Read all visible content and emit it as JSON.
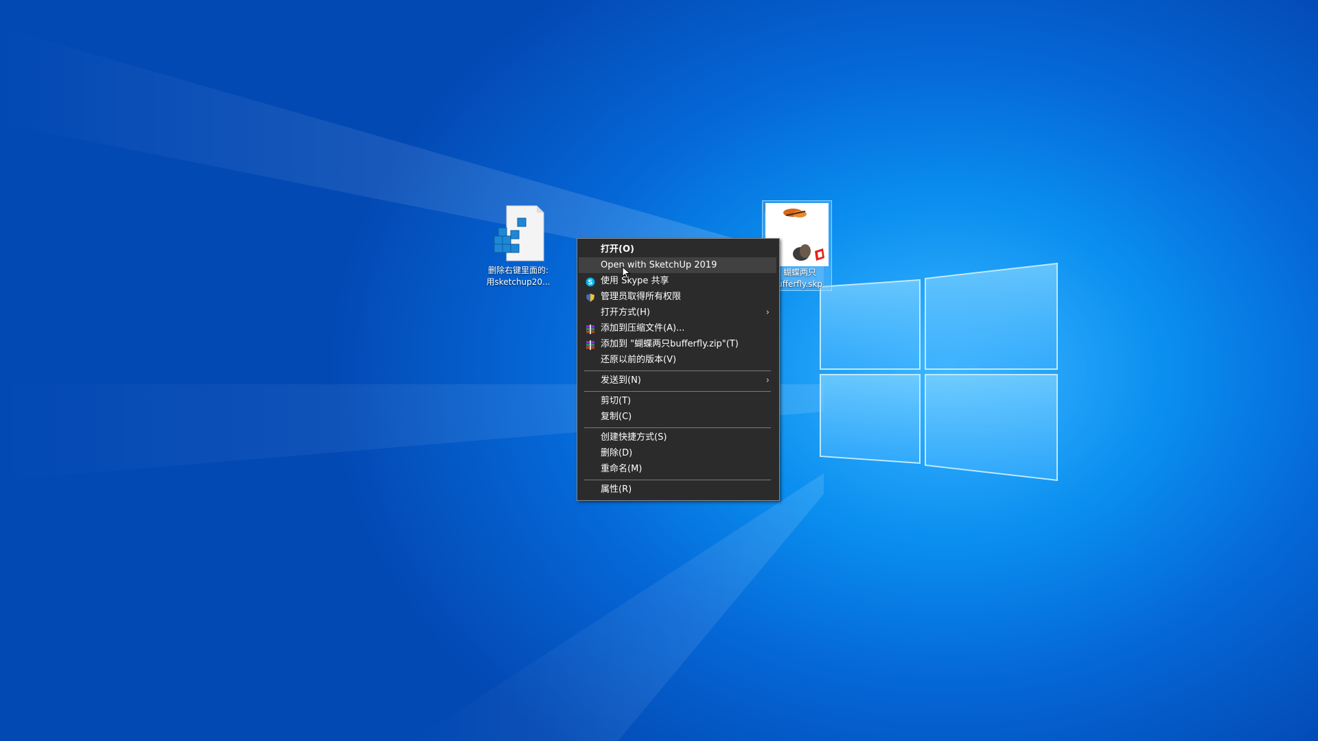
{
  "desktop": {
    "icons": [
      {
        "label_line1": "删除右键里面的:",
        "label_line2": "用sketchup20..."
      },
      {
        "label_line1": "蝴蝶两只",
        "label_line2": "ufferfly.skp",
        "checked": "✓"
      }
    ]
  },
  "context_menu": {
    "items": [
      {
        "label": "打开(O)"
      },
      {
        "label": "Open with SketchUp 2019"
      },
      {
        "label": "使用 Skype 共享",
        "icon": "skype-icon"
      },
      {
        "label": "管理员取得所有权限",
        "icon": "shield-icon"
      },
      {
        "label": "打开方式(H)",
        "arrow": "›"
      },
      {
        "label": "添加到压缩文件(A)...",
        "icon": "winrar-icon"
      },
      {
        "label": "添加到 \"蝴蝶两只bufferfly.zip\"(T)",
        "icon": "winrar-icon"
      },
      {
        "label": "还原以前的版本(V)"
      },
      {
        "label": "发送到(N)",
        "arrow": "›"
      },
      {
        "label": "剪切(T)"
      },
      {
        "label": "复制(C)"
      },
      {
        "label": "创建快捷方式(S)"
      },
      {
        "label": "删除(D)"
      },
      {
        "label": "重命名(M)"
      },
      {
        "label": "属性(R)"
      }
    ]
  },
  "colors": {
    "menu_bg": "#2b2b2b",
    "menu_hover": "#414141",
    "desktop_blue": "#0a8ff0"
  }
}
